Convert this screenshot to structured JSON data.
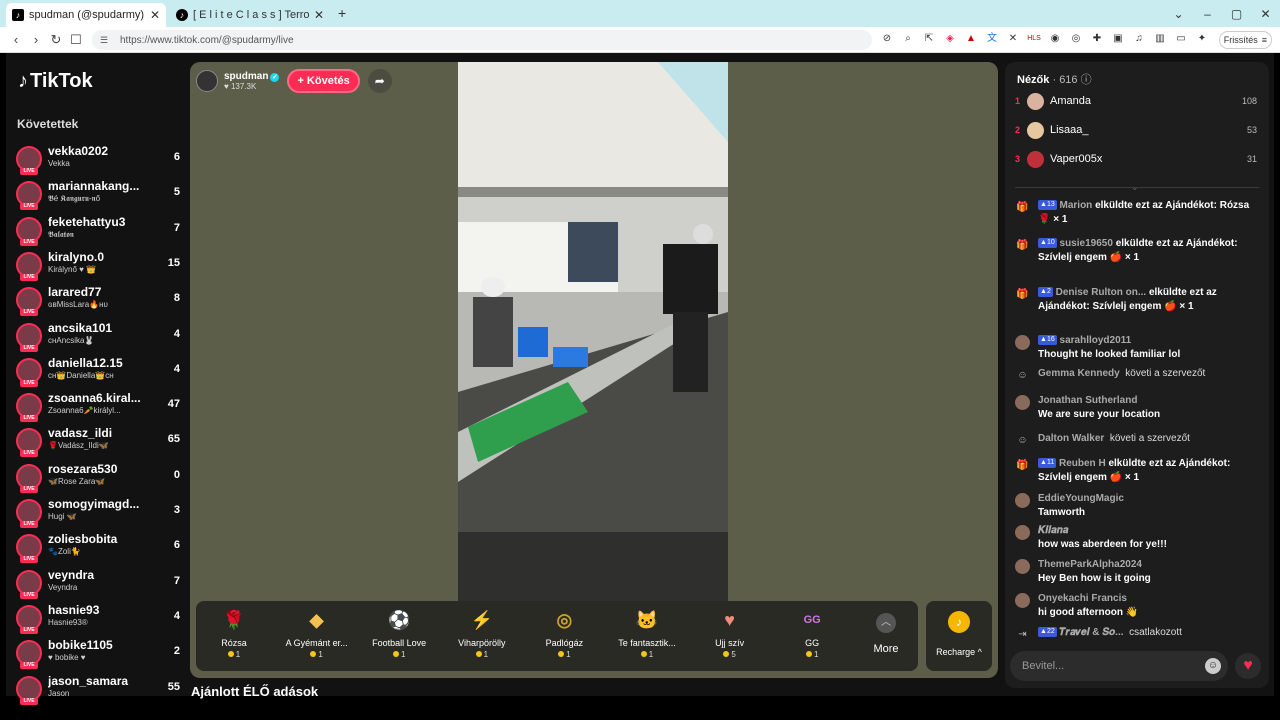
{
  "browser": {
    "tabs": [
      {
        "title": "spudman (@spudarmy) ÉLŐ a",
        "icon": "tiktok-icon"
      },
      {
        "title": "[ E l i t e   C l a s s ] TerrorMo",
        "icon": "tiktok-icon"
      }
    ],
    "new_tab": "+",
    "url": "https://www.tiktok.com/@spudarmy/live",
    "refresh_label": "Frissítés",
    "controls": {
      "min": "–",
      "max": "▢",
      "close": "✕",
      "chevron": "⌄"
    }
  },
  "app": {
    "logo": "TikTok",
    "followed_heading": "Követettek"
  },
  "followed": [
    {
      "name": "vekka0202",
      "sub": "Vekka",
      "count": "6"
    },
    {
      "name": "mariannakang...",
      "sub": "𝕭é 𝕶𝖆𝖓𝖌𝖚𝖗𝖚-𝖓ő",
      "count": "5"
    },
    {
      "name": "feketehattyu3",
      "sub": "𝕭𝖆𝖑𝖆𝖙𝖔𝖓",
      "count": "7"
    },
    {
      "name": "kiralyno.0",
      "sub": "Királynő ♥ 👑",
      "count": "15"
    },
    {
      "name": "larared77",
      "sub": "ɢʙMissLara🔥ʜᴜ",
      "count": "8"
    },
    {
      "name": "ancsika101",
      "sub": "ᴄʜAncsika🐰",
      "count": "4"
    },
    {
      "name": "daniella12.15",
      "sub": "ᴄʜ👑Daniella👑ᴄʜ",
      "count": "4"
    },
    {
      "name": "zsoanna6.kiral...",
      "sub": "Zsoanna6🥕királyl...",
      "count": "47"
    },
    {
      "name": "vadasz_ildi",
      "sub": "🌹Vadász_Ildi🦋",
      "count": "65"
    },
    {
      "name": "rosezara530",
      "sub": "🦋Rose Zara🦋",
      "count": "0"
    },
    {
      "name": "somogyimagd...",
      "sub": "Hugi 🦋",
      "count": "3"
    },
    {
      "name": "zoliesbobita",
      "sub": "🐾Zoli🐈",
      "count": "6"
    },
    {
      "name": "veyndra",
      "sub": "Veyndra",
      "count": "7"
    },
    {
      "name": "hasnie93",
      "sub": "Hasnie93®",
      "count": "4"
    },
    {
      "name": "bobike1105",
      "sub": "♥ bobike ♥",
      "count": "2"
    },
    {
      "name": "jason_samara",
      "sub": "Jason",
      "count": "55"
    }
  ],
  "host": {
    "name": "spudman",
    "likes": "137.3K",
    "follow_label": "+ Követés"
  },
  "gifts": [
    {
      "name": "Rózsa",
      "price": "1",
      "icon": "rose-icon",
      "color": "#e8334a"
    },
    {
      "name": "A Gyémánt er...",
      "price": "1",
      "icon": "diamond-icon",
      "color": "#f2c14e"
    },
    {
      "name": "Football Love",
      "price": "1",
      "icon": "football-icon",
      "color": "#e84c6b"
    },
    {
      "name": "Viharpörölly",
      "price": "1",
      "icon": "hammer-icon",
      "color": "#7aa6d6"
    },
    {
      "name": "Padlógáz",
      "price": "1",
      "icon": "pedal-icon",
      "color": "#c9a227"
    },
    {
      "name": "Te fantasztik...",
      "price": "1",
      "icon": "cat-icon",
      "color": "#d9a77b"
    },
    {
      "name": "Ujj szív",
      "price": "5",
      "icon": "finger-heart-icon",
      "color": "#f08a7a"
    },
    {
      "name": "GG",
      "price": "1",
      "icon": "gg-icon",
      "color": "#c878f0"
    }
  ],
  "more_label": "More",
  "recharge_label": "Recharge ^",
  "recommended_heading": "Ajánlott ÉLŐ adások",
  "viewers": {
    "title": "Nézők",
    "count": "· 616",
    "list": [
      {
        "rank": "1",
        "name": "Amanda",
        "score": "108"
      },
      {
        "rank": "2",
        "name": "Lisaaa_",
        "score": "53"
      },
      {
        "rank": "3",
        "name": "Vaper005x",
        "score": "31"
      }
    ]
  },
  "chat": [
    {
      "icon": "gift-icon",
      "level": "13",
      "user": "Marion",
      "text": "elküldte ezt az Ajándékot: Rózsa 🌹 × 1",
      "type": "gift"
    },
    {
      "icon": "gift-icon",
      "level": "10",
      "user": "susie19650",
      "text": "elküldte ezt az Ajándékot: Szívlelj engem 🍎 × 1",
      "type": "gift"
    },
    {
      "icon": "gift-icon",
      "level": "2",
      "user": "Denise Rulton on...",
      "text": "elküldte ezt az Ajándékot: Szívlelj engem 🍎 × 1",
      "type": "gift"
    },
    {
      "icon": "avatar",
      "level": "16",
      "user": "sarahlloyd2011",
      "text": "Thought he looked familiar lol",
      "type": "comment"
    },
    {
      "icon": "follow-icon",
      "level": "",
      "user": "Gemma Kennedy",
      "text": "követi a szervezőt",
      "type": "follow"
    },
    {
      "icon": "avatar",
      "level": "",
      "user": "Jonathan Sutherland",
      "text": "We are sure your location",
      "type": "comment"
    },
    {
      "icon": "follow-icon",
      "level": "",
      "user": "Dalton Walker",
      "text": "követi a szervezőt",
      "type": "follow"
    },
    {
      "icon": "gift-icon",
      "level": "11",
      "user": "Reuben H",
      "text": "elküldte ezt az Ajándékot: Szívlelj engem 🍎 × 1",
      "type": "gift"
    },
    {
      "icon": "avatar",
      "level": "",
      "user": "EddieYoungMagic",
      "text": "Tamworth",
      "type": "comment"
    },
    {
      "icon": "avatar",
      "level": "",
      "user": "𝑲𝒊𝒊𝒂𝒏𝒂",
      "text": "how was aberdeen for ye!!!",
      "type": "comment"
    },
    {
      "icon": "avatar",
      "level": "",
      "user": "ThemeParkAlpha2024",
      "text": "Hey Ben how is it going",
      "type": "comment"
    },
    {
      "icon": "avatar",
      "level": "",
      "user": "Onyekachi Francis",
      "text": "hi good afternoon 👋",
      "type": "comment"
    },
    {
      "icon": "join-icon",
      "level": "22",
      "user": "𝑻𝒓𝒂𝒗𝒆𝒍 & 𝑺𝒐...",
      "text": "csatlakozott",
      "type": "join"
    }
  ],
  "input_placeholder": "Bevitel..."
}
